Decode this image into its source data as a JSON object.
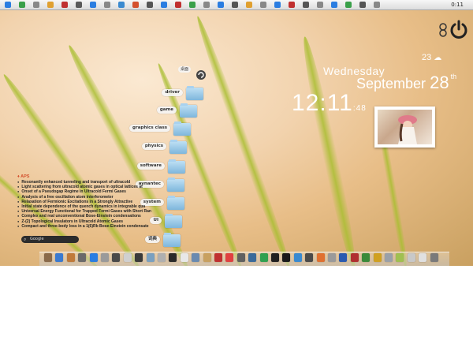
{
  "menubar": {
    "clock": "0:11",
    "icon_colors": [
      "#2a7de1",
      "#3aa04a",
      "#888888",
      "#e0a030",
      "#c03030",
      "#5a5a5a",
      "#2a7de1",
      "#888888",
      "#3a8ad0",
      "#d4502d",
      "#555555",
      "#2a7de1",
      "#c03030",
      "#3aa04a",
      "#888888",
      "#2a7de1",
      "#555555",
      "#e0a030",
      "#888888",
      "#2a7de1",
      "#c03030",
      "#555555",
      "#888888",
      "#2a7de1",
      "#3aa04a",
      "#555555",
      "#888888"
    ]
  },
  "widgets": {
    "weather_temp": "23",
    "weather_icon": "cloud-icon",
    "day_name": "Wednesday",
    "month": "September",
    "day_num": "28",
    "day_suffix": "th",
    "time": "12:11",
    "seconds": ":48"
  },
  "folders": [
    {
      "label": "driver"
    },
    {
      "label": "game"
    },
    {
      "label": "graphics class"
    },
    {
      "label": "physics"
    },
    {
      "label": "software"
    },
    {
      "label": "aynantec"
    },
    {
      "label": "system"
    },
    {
      "label": "UI"
    },
    {
      "label": "词典"
    }
  ],
  "aps": {
    "title": "APS",
    "items": [
      "Resonantly enhanced tunneling and transport of ultracold",
      "Light scattering from ultracold atomic gases in optical lattices at",
      "Onset of a Pseudogap Regime in Ultracold Fermi Gases",
      "Analysis of a free oscillation atom interferometer",
      "Relaxation of Fermionic Excitations in a Strongly Attractive",
      "Initial state dependence of the quench dynamics in integrable qua",
      "Universal Energy Functional for Trapped Fermi Gases with Short Ran",
      "Complex and real unconventional Bose-Einstein condensations",
      "Z-(2) Topological Insulators in Ultracold Atomic Gases",
      "Compact and three-body loss in a 1(6)Rb Bose-Einstein condensate"
    ]
  },
  "search": {
    "label": "Google"
  },
  "dock": {
    "icon_colors": [
      "#8a6a4a",
      "#3a7ad0",
      "#c07a3a",
      "#6a6a6a",
      "#2a7de1",
      "#9a9a9a",
      "#4a4a4a",
      "#d0d0d0",
      "#3a3a3a",
      "#7aa0c0",
      "#b0b0b0",
      "#2a2a2a",
      "#e8e8e8",
      "#6a8ab0",
      "#c8a060",
      "#c03030",
      "#e04040",
      "#606060",
      "#3a6a9a",
      "#30a050",
      "#202020",
      "#1a1a1a",
      "#3a8ad0",
      "#4a4a4a",
      "#e07030",
      "#9a9a9a",
      "#2a5ab0",
      "#b03030",
      "#3a8a3a",
      "#d0a020",
      "#9aa0a8",
      "#a0c050",
      "#c8c8c8",
      "#e0e0e0",
      "#7a7a7a"
    ]
  }
}
